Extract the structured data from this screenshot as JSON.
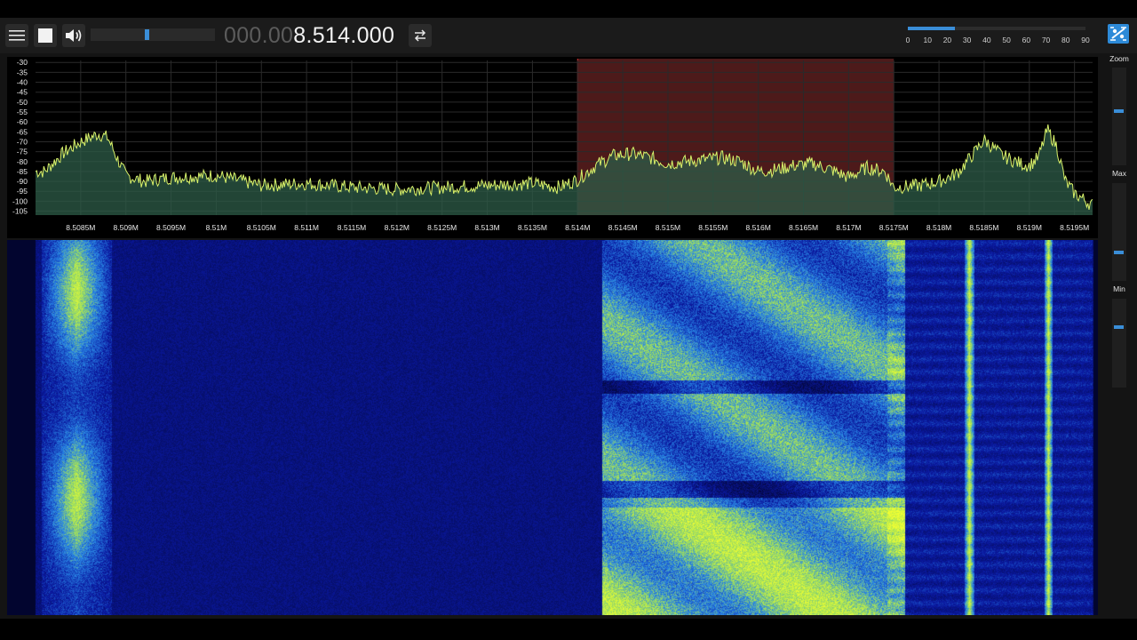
{
  "toolbar": {
    "menu_icon": "hamburger-menu-icon",
    "stop_icon": "stop-square-icon",
    "volume_icon": "speaker-volume-icon",
    "volume_level": 0.45,
    "frequency_dim": "000.00",
    "frequency_main": "8.514.000",
    "swap_icon": "swap-arrows-icon",
    "settings_icon": "settings-tune-icon"
  },
  "snr_scale": {
    "ticks": [
      "0",
      "10",
      "20",
      "30",
      "40",
      "50",
      "60",
      "70",
      "80",
      "90"
    ],
    "level": 24
  },
  "right_panel": {
    "zoom_label": "Zoom",
    "max_label": "Max",
    "min_label": "Min",
    "zoom_level": 0.85,
    "max_level": 0.45,
    "min_level": 0.8
  },
  "chart_data": {
    "type": "line",
    "title": "",
    "xlabel": "",
    "ylabel": "",
    "x_tick_labels": [
      "8.5085M",
      "8.509M",
      "8.5095M",
      "8.51M",
      "8.5105M",
      "8.511M",
      "8.5115M",
      "8.512M",
      "8.5125M",
      "8.513M",
      "8.5135M",
      "8.514M",
      "8.5145M",
      "8.515M",
      "8.5155M",
      "8.516M",
      "8.5165M",
      "8.517M",
      "8.5175M",
      "8.518M",
      "8.5185M",
      "8.519M",
      "8.5195M"
    ],
    "y_tick_labels": [
      "-30",
      "-35",
      "-40",
      "-45",
      "-50",
      "-55",
      "-60",
      "-65",
      "-70",
      "-75",
      "-80",
      "-85",
      "-90",
      "-95",
      "-100",
      "-105"
    ],
    "xlim": [
      8.508,
      8.5197
    ],
    "ylim": [
      -107,
      -29
    ],
    "grid": true,
    "passband": [
      8.514,
      8.5175
    ],
    "series": [
      {
        "x": [
          8.5081,
          8.5083,
          8.5085,
          8.5087,
          8.5088,
          8.5089,
          8.509,
          8.5092,
          8.5095,
          8.51,
          8.5105,
          8.511,
          8.5115,
          8.512,
          8.5125,
          8.513,
          8.5135,
          8.5138,
          8.514,
          8.5142,
          8.5144,
          8.5146,
          8.5148,
          8.515,
          8.5152,
          8.5154,
          8.5156,
          8.5158,
          8.516,
          8.5162,
          8.5164,
          8.5166,
          8.5168,
          8.517,
          8.5172,
          8.5174,
          8.5175,
          8.5178,
          8.518,
          8.5182,
          8.5184,
          8.5185,
          8.5187,
          8.5189,
          8.519,
          8.5191,
          8.5192,
          8.5193,
          8.5194,
          8.5195,
          8.5197
        ],
        "y": [
          -85,
          -76,
          -70,
          -66,
          -68,
          -78,
          -87,
          -90,
          -88,
          -87,
          -92,
          -91,
          -93,
          -94,
          -93,
          -92,
          -91,
          -93,
          -89,
          -82,
          -77,
          -76,
          -78,
          -81,
          -80,
          -79,
          -78,
          -80,
          -85,
          -84,
          -82,
          -81,
          -84,
          -88,
          -83,
          -85,
          -93,
          -92,
          -90,
          -86,
          -75,
          -69,
          -77,
          -81,
          -82,
          -78,
          -64,
          -72,
          -90,
          -96,
          -102
        ]
      }
    ]
  }
}
